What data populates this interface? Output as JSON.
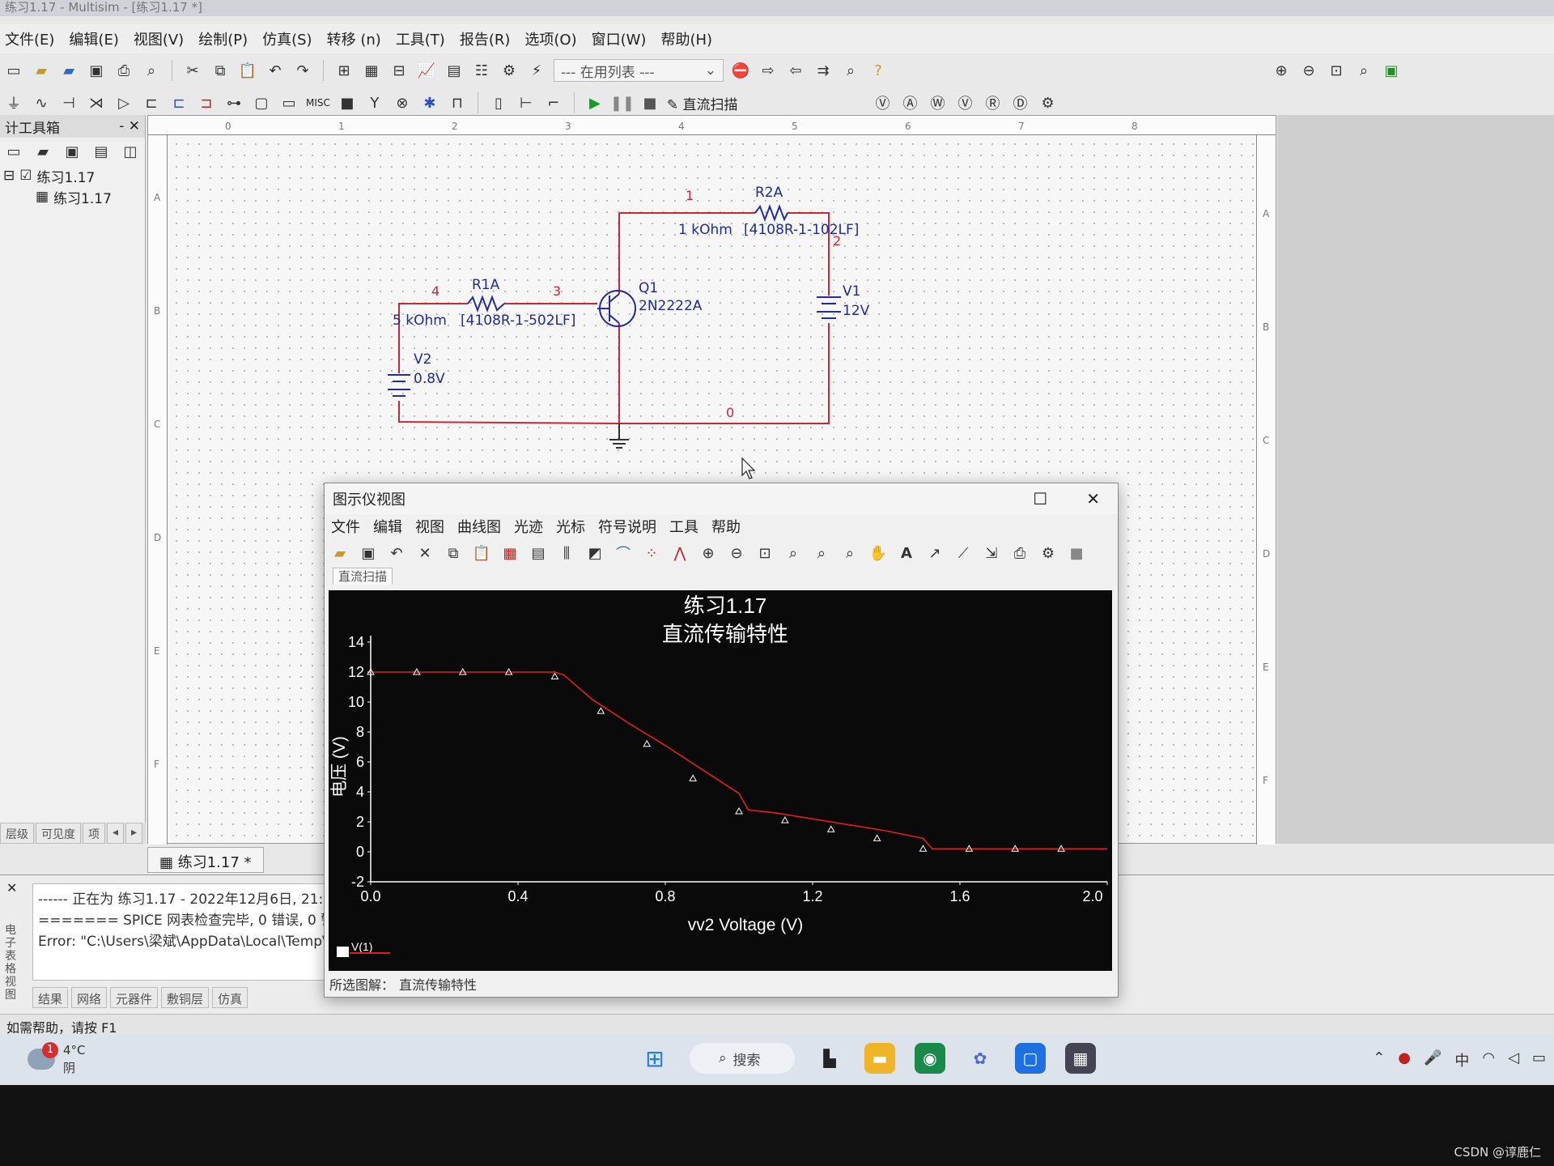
{
  "window": {
    "title": "练习1.17 - Multisim - [练习1.17 *]"
  },
  "menubar": [
    "文件(E)",
    "编辑(E)",
    "视图(V)",
    "绘制(P)",
    "仿真(S)",
    "转移 (n)",
    "工具(T)",
    "报告(R)",
    "选项(O)",
    "窗口(W)",
    "帮助(H)"
  ],
  "toolbar": {
    "in_use_list": "--- 在用列表 ---",
    "dc_sweep_label": "直流扫描",
    "misc_label": "MISC"
  },
  "toolbox": {
    "title": "计工具箱",
    "tree_root": "练习1.17",
    "tree_child": "练习1.17",
    "tabs": [
      "层级",
      "可见度",
      "项"
    ]
  },
  "document_tab": "练习1.17 *",
  "schematic": {
    "R2A": {
      "name": "R2A",
      "value": "1 kOhm",
      "part": "[4108R-1-102LF]"
    },
    "R1A": {
      "name": "R1A",
      "value": "5 kOhm",
      "part": "[4108R-1-502LF]"
    },
    "Q1": {
      "name": "Q1",
      "part": "2N2222A"
    },
    "V1": {
      "name": "V1",
      "value": "12V"
    },
    "V2": {
      "name": "V2",
      "value": "0.8V"
    },
    "nodes": [
      "1",
      "2",
      "3",
      "4",
      "0"
    ],
    "ruler_top": [
      "0",
      "1",
      "2",
      "3",
      "4",
      "5",
      "6",
      "7",
      "8"
    ],
    "ruler_side": [
      "A",
      "B",
      "C",
      "D",
      "E",
      "F"
    ]
  },
  "output": {
    "lines": [
      "------ 正在为 练习1.17 - 2022年12月6日, 21:",
      "======= SPICE 网表检查完毕, 0 错误, 0 警告",
      "Error: \"C:\\Users\\梁斌\\AppData\\Local\\Temp\\"
    ],
    "tabs": [
      "结果",
      "网络",
      "元器件",
      "敷铜层",
      "仿真"
    ],
    "side_label": "电子表格视图"
  },
  "statusbar": "如需帮助，请按 F1",
  "taskbar": {
    "weather_temp": "4°C",
    "weather_desc": "阴",
    "weather_badge": "1",
    "search": "搜索",
    "tray_lang": "中"
  },
  "grapher": {
    "title": "图示仪视图",
    "menu": [
      "文件",
      "编辑",
      "视图",
      "曲线图",
      "光迹",
      "光标",
      "符号说明",
      "工具",
      "帮助"
    ],
    "tab": "直流扫描",
    "status_label": "所选图解：",
    "status_value": "直流传输特性"
  },
  "chart_data": {
    "type": "line",
    "title": "练习1.17",
    "subtitle": "直流传输特性",
    "xlabel": "vv2 Voltage (V)",
    "ylabel": "电压 (V)",
    "xlim": [
      0.0,
      2.0
    ],
    "ylim": [
      -2,
      14
    ],
    "xticks": [
      "0.0",
      "0.4",
      "0.8",
      "1.2",
      "1.6",
      "2.0"
    ],
    "yticks": [
      "14",
      "12",
      "10",
      "8",
      "6",
      "4",
      "2",
      "0",
      "-2"
    ],
    "grid": false,
    "legend": "bottom-left",
    "background": "#0a0a0a",
    "line_color": "#e01e1e",
    "series": [
      {
        "name": "V(1)",
        "x": [
          0.0,
          0.1,
          0.2,
          0.3,
          0.4,
          0.5,
          0.525,
          0.6,
          0.7,
          0.8,
          0.9,
          1.0,
          1.025,
          1.1,
          1.2,
          1.3,
          1.4,
          1.5,
          1.525,
          1.6,
          1.7,
          1.8,
          1.9,
          2.0
        ],
        "y": [
          12.0,
          12.0,
          12.0,
          12.0,
          12.0,
          12.0,
          11.8,
          10.2,
          8.6,
          7.1,
          5.5,
          3.9,
          2.8,
          2.6,
          2.2,
          1.8,
          1.4,
          0.9,
          0.2,
          0.2,
          0.2,
          0.2,
          0.2,
          0.2
        ],
        "markers_x": [
          0.0,
          0.125,
          0.25,
          0.375,
          0.5,
          0.625,
          0.75,
          0.875,
          1.0,
          1.125,
          1.25,
          1.375,
          1.5,
          1.625,
          1.75,
          1.875
        ],
        "markers_y": [
          12.0,
          12.0,
          12.0,
          12.0,
          11.7,
          9.4,
          7.2,
          4.9,
          2.7,
          2.1,
          1.5,
          0.9,
          0.2,
          0.2,
          0.2,
          0.2
        ]
      }
    ]
  }
}
